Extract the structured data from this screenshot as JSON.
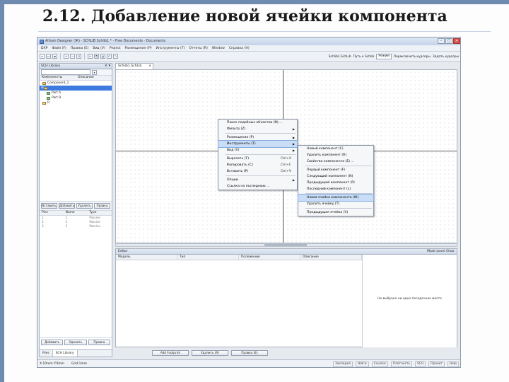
{
  "slide": {
    "title": "2.12. Добавление новой ячейки компонента"
  },
  "window": {
    "title": "Altium Designer (Ж)  - SCHLIB Schlib1 * - Free Documents  - Documents",
    "menu": [
      "DXP",
      "Файл (F)",
      "Правка (E)",
      "Вид (V)",
      "Project",
      "Размещение (P)",
      "Инструменты (T)",
      "Отчеты (R)",
      "Window",
      "Справка (H)"
    ],
    "toolbar_right": [
      "Schlib1.SchLib",
      "Путь к Schlib",
      "Режим",
      "Переключить курсоры",
      "Задать курсоры"
    ],
    "toolbar_combo": "Режим"
  },
  "left_panel": {
    "title": "SCH Library",
    "columns": [
      "Компоненты",
      "Описание"
    ],
    "tree": [
      "Component_1",
      "",
      "Part A",
      "Part B",
      "R"
    ],
    "buttons": [
      "Вставить",
      "Добавить",
      "Удалить",
      "Правка"
    ],
    "pin_columns": [
      "Pins",
      "Name",
      "Type"
    ],
    "pins": [
      [
        "1",
        "1",
        "Passive"
      ],
      [
        "2",
        "2",
        "Passive"
      ],
      [
        "3",
        "3",
        "Passive"
      ]
    ],
    "bottom_buttons": [
      "Добавить",
      "Удалить",
      "Правка"
    ],
    "tabs": [
      "Files",
      "SCH Library"
    ]
  },
  "doc_tab": "Schlib1.SchLib",
  "context_menu": {
    "items": [
      {
        "label": "Поиск подобных объектов (N) ...",
        "shortcut": "",
        "arrow": false
      },
      {
        "label": "Фильтр (Z)",
        "shortcut": "",
        "arrow": true
      },
      {
        "sep": true
      },
      {
        "label": "Размещение (P)",
        "shortcut": "",
        "arrow": true
      },
      {
        "label": "Инструменты (T)",
        "shortcut": "",
        "arrow": true,
        "highlight": true
      },
      {
        "label": "Вид (V)",
        "shortcut": "",
        "arrow": true
      },
      {
        "sep": true
      },
      {
        "label": "Вырезать (T)",
        "shortcut": "Ctrl+X",
        "arrow": false
      },
      {
        "label": "Копировать (C)",
        "shortcut": "Ctrl+C",
        "arrow": false
      },
      {
        "label": "Вставить (P)",
        "shortcut": "Ctrl+V",
        "arrow": false
      },
      {
        "sep": true
      },
      {
        "label": "Опции",
        "shortcut": "",
        "arrow": true
      },
      {
        "label": "Ссылка на последнюю ...",
        "shortcut": "",
        "arrow": false
      }
    ],
    "submenu": [
      {
        "label": "Новый компонент (C)",
        "shortcut": "",
        "highlight": false
      },
      {
        "label": "Удалить компонент (R)",
        "shortcut": "",
        "highlight": false
      },
      {
        "label": "Свойства компонента (E) ...",
        "shortcut": "",
        "highlight": false
      },
      {
        "sep": true
      },
      {
        "label": "Первый компонент (F)",
        "shortcut": "",
        "highlight": false
      },
      {
        "label": "Следующий компонент (N)",
        "shortcut": "",
        "highlight": false
      },
      {
        "label": "Предыдущий компонент (P)",
        "shortcut": "",
        "highlight": false
      },
      {
        "label": "Последний компонент (L)",
        "shortcut": "",
        "highlight": false
      },
      {
        "sep": true
      },
      {
        "label": "Новая ячейка компонента (W)",
        "shortcut": "",
        "highlight": true
      },
      {
        "label": "Удалить ячейку (T)",
        "shortcut": "",
        "highlight": false
      },
      {
        "sep": true
      },
      {
        "label": "Предыдущая ячейка (V)",
        "shortcut": "",
        "highlight": false
      }
    ]
  },
  "editor": {
    "title": "Editor",
    "mask": "Mask Level",
    "clear": "Clear",
    "columns": [
      "Модель",
      "Тип",
      "Положение",
      "Описание"
    ],
    "no_model": "Не выбрано ни одно посадочное место",
    "buttons": [
      "Add Footprint",
      "Удалить (R)",
      "Правка (E)"
    ]
  },
  "statusbar": {
    "left": [
      "X:10mm Y:0mm",
      "Grid:1mm"
    ],
    "right": [
      "Закладка",
      "Шаги",
      "Ссылка",
      "Плотность",
      "SCH",
      "Проект",
      "Help"
    ]
  }
}
